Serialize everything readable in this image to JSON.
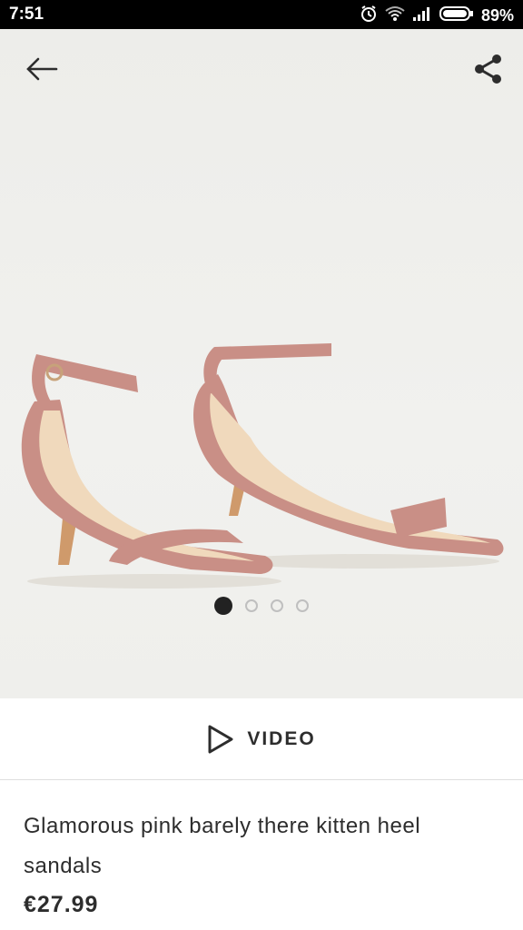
{
  "status_bar": {
    "time": "7:51",
    "battery": "89%",
    "icons": [
      "alarm-icon",
      "wifi-icon",
      "signal-icon",
      "battery-icon"
    ]
  },
  "hero": {
    "back_icon": "arrow-left-icon",
    "share_icon": "share-icon",
    "image_count": 4,
    "active_index": 0
  },
  "video": {
    "label": "VIDEO",
    "icon": "play-icon"
  },
  "product": {
    "title": "Glamorous pink barely there kitten heel sandals",
    "price": "€27.99"
  },
  "colors": {
    "status_bar": "#000000",
    "hero_bg": "#efefec",
    "suede_pink": "#c98f86",
    "insole": "#f0d9bc",
    "text": "#2d2d2d",
    "dot_active": "#222222",
    "dot_inactive": "#bfbfbf"
  }
}
